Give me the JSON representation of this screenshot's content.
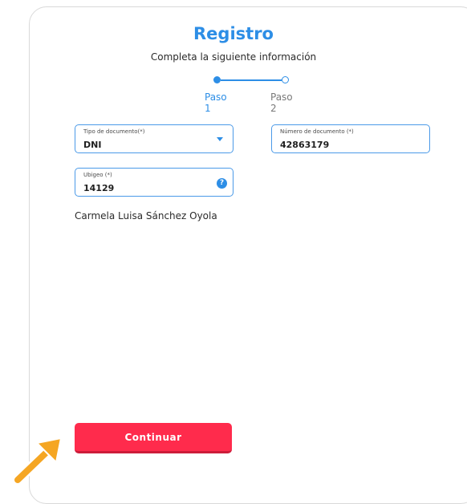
{
  "header": {
    "title": "Registro",
    "subtitle": "Completa la siguiente información"
  },
  "stepper": {
    "steps": [
      {
        "label": "Paso 1",
        "active": true
      },
      {
        "label": "Paso 2",
        "active": false
      }
    ]
  },
  "form": {
    "document_type": {
      "label": "Tipo de documento(*)",
      "value": "DNI"
    },
    "document_number": {
      "label": "Número de documento (*)",
      "value": "42863179"
    },
    "ubigeo": {
      "label": "Ubigeo (*)",
      "value": "14129"
    },
    "help_icon": "?"
  },
  "person_name": "Carmela Luisa Sánchez Oyola",
  "actions": {
    "continue_label": "Continuar"
  },
  "colors": {
    "accent": "#2d8ee6",
    "primary_button": "#ff2b4c",
    "arrow": "#f5a623"
  }
}
